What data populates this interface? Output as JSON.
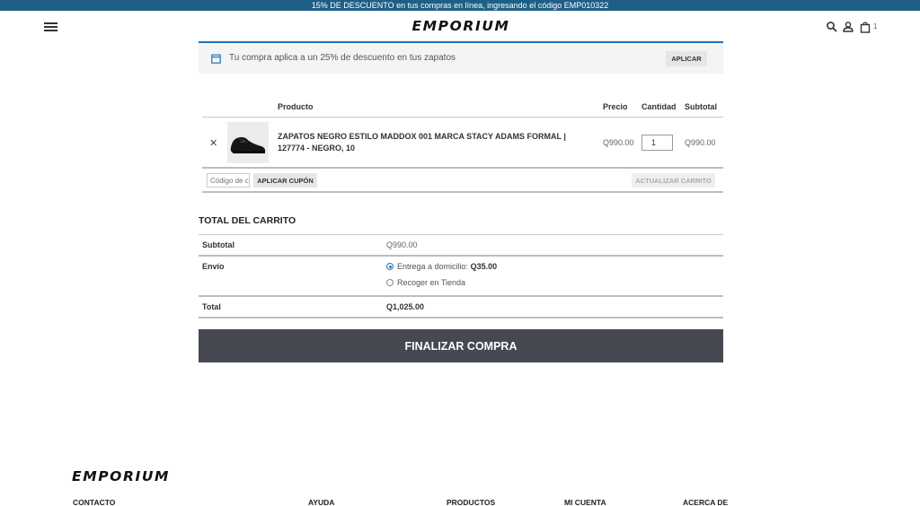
{
  "promo": {
    "text": "15% DE DESCUENTO en tus compras en línea, ingresando el código EMP010322"
  },
  "header": {
    "logo": "EMPORIUM",
    "cart_count": "1"
  },
  "notice": {
    "text": "Tu compra aplica a un 25% de descuento en tus zapatos",
    "apply_label": "APLICAR"
  },
  "cart_table": {
    "headers": {
      "product": "Producto",
      "price": "Precio",
      "quantity": "Cantidad",
      "subtotal": "Subtotal"
    },
    "items": [
      {
        "name": "ZAPATOS NEGRO ESTILO MADDOX 001 MARCA STACY ADAMS FORMAL | 127774 - NEGRO, 10",
        "price": "Q990.00",
        "quantity": "1",
        "subtotal": "Q990.00"
      }
    ],
    "coupon_placeholder": "Código de cupón",
    "coupon_button": "APLICAR CUPÓN",
    "update_button": "ACTUALIZAR CARRITO"
  },
  "totals": {
    "title": "TOTAL DEL CARRITO",
    "subtotal_label": "Subtotal",
    "subtotal_value": "Q990.00",
    "shipping_label": "Envío",
    "shipping_options": [
      {
        "label": "Entrega a domicilio:",
        "price": "Q35.00",
        "selected": true
      },
      {
        "label": "Recoger en Tienda",
        "price": "",
        "selected": false
      }
    ],
    "total_label": "Total",
    "total_value": "Q1,025.00"
  },
  "checkout_button": "FINALIZAR COMPRA",
  "footer": {
    "logo": "EMPORIUM",
    "columns": [
      "CONTACTO",
      "AYUDA",
      "PRODUCTOS",
      "MI CUENTA",
      "ACERCA DE"
    ]
  },
  "colors": {
    "promo_bg": "#1e5f86",
    "accent": "#1e73be",
    "checkout_bg": "#464852"
  }
}
